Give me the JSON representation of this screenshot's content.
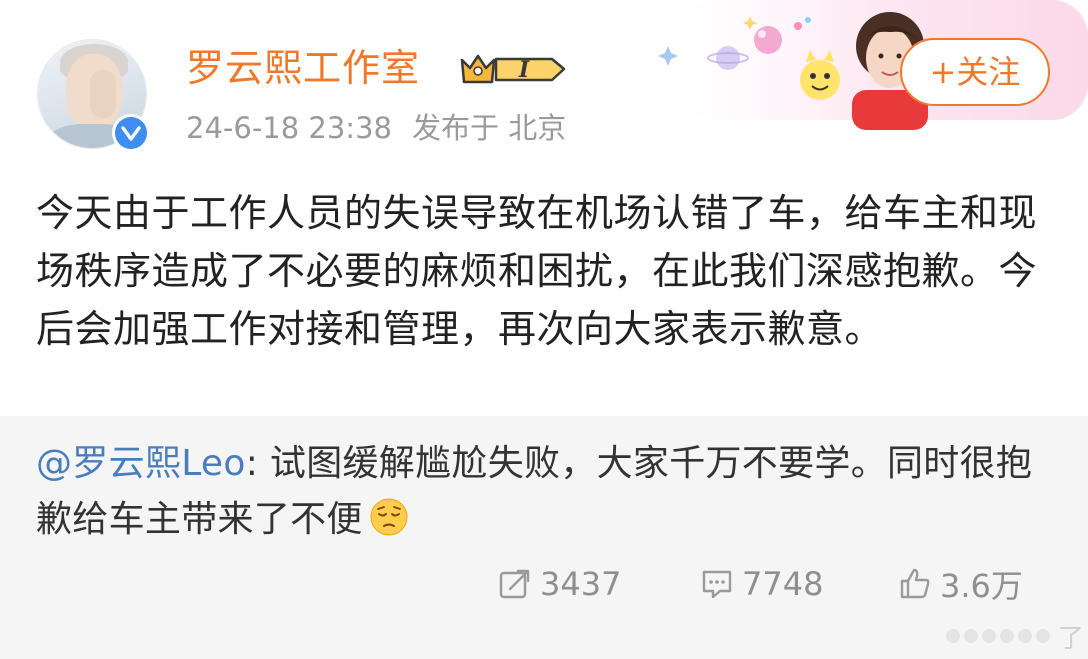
{
  "post": {
    "author": "罗云熙工作室",
    "member_level": "I",
    "time": "24-6-18 23:38",
    "location": "发布于 北京",
    "follow_label": "+关注",
    "text": "今天由于工作人员的失误导致在机场认错了车，给车主和现场秩序造成了不必要的麻烦和困扰，在此我们深感抱歉。今后会加强工作对接和管理，再次向大家表示歉意。"
  },
  "repost": {
    "author": "@罗云熙Leo",
    "separator": ": ",
    "text": "试图缓解尴尬失败，大家千万不要学。同时很抱歉给车主带来了不便"
  },
  "stats": {
    "reposts": "3437",
    "comments": "7748",
    "likes": "3.6万"
  },
  "watermark": {
    "text": "了"
  },
  "colors": {
    "accent": "#f0782b",
    "link": "#4a7dbd",
    "verified": "#3d8ef0",
    "meta": "#9a9a9a",
    "repost_bg": "#f5f5f5"
  },
  "icons": [
    "verified-icon",
    "crown-badge-icon",
    "repost-icon",
    "comment-icon",
    "like-icon",
    "pensive-emoji-icon"
  ]
}
